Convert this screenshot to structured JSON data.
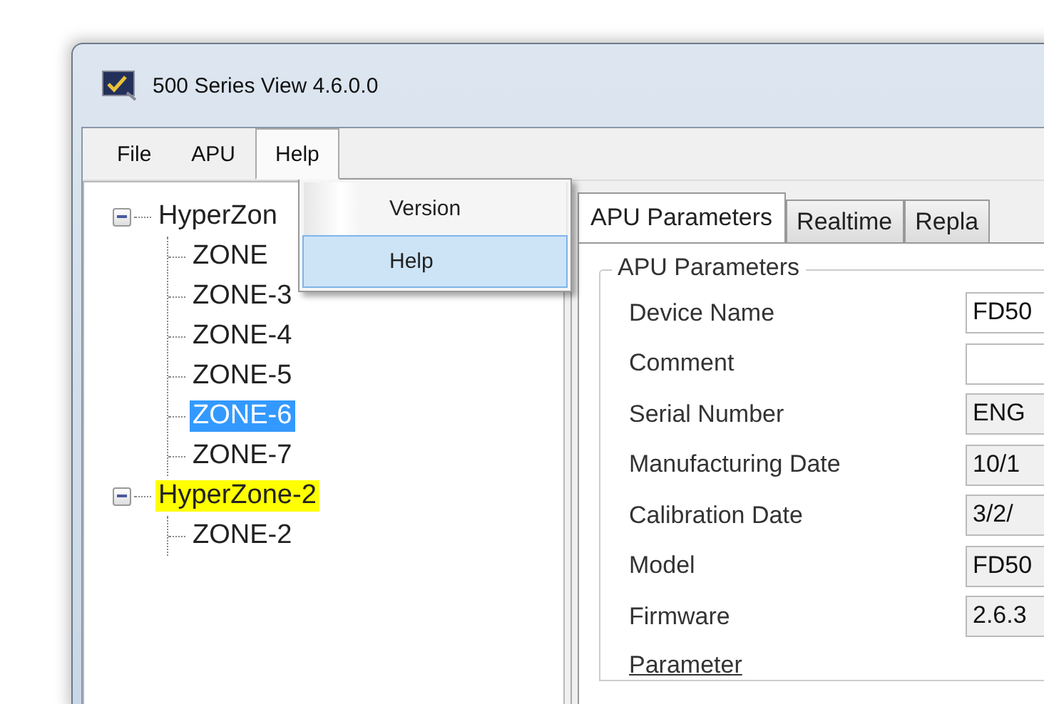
{
  "window": {
    "title": "500 Series View 4.6.0.0"
  },
  "menu": [
    {
      "label": "File",
      "open": false
    },
    {
      "label": "APU",
      "open": false
    },
    {
      "label": "Help",
      "open": true,
      "items": [
        {
          "label": "Version",
          "selected": false
        },
        {
          "label": "Help",
          "selected": true
        }
      ]
    }
  ],
  "tree": [
    {
      "label": "HyperZon",
      "expanded": true,
      "selected": false,
      "highlighted": false,
      "children": [
        {
          "label": "ZONE",
          "selected": false,
          "highlighted": false
        },
        {
          "label": "ZONE-3",
          "selected": false,
          "highlighted": false
        },
        {
          "label": "ZONE-4",
          "selected": false,
          "highlighted": false
        },
        {
          "label": "ZONE-5",
          "selected": false,
          "highlighted": false
        },
        {
          "label": "ZONE-6",
          "selected": true,
          "highlighted": false
        },
        {
          "label": "ZONE-7",
          "selected": false,
          "highlighted": false
        }
      ]
    },
    {
      "label": "HyperZone-2",
      "expanded": true,
      "selected": false,
      "highlighted": true,
      "children": [
        {
          "label": "ZONE-2",
          "selected": false,
          "highlighted": false
        }
      ]
    }
  ],
  "tabs": [
    {
      "label": "APU Parameters",
      "selected": true
    },
    {
      "label": "Realtime",
      "selected": false
    },
    {
      "label": "Repla",
      "selected": false
    }
  ],
  "group": {
    "title": "APU Parameters",
    "fields": [
      {
        "label": "Device Name",
        "value": "FD50",
        "readonly": false
      },
      {
        "label": "Comment",
        "readonly": false
      },
      {
        "label": "Serial Number",
        "value": "ENG",
        "readonly": true
      },
      {
        "label": "Manufacturing Date",
        "value": "10/1",
        "readonly": true
      },
      {
        "label": "Calibration Date",
        "value": "3/2/",
        "readonly": true
      },
      {
        "label": "Model",
        "value": "FD50",
        "readonly": true
      },
      {
        "label": "Firmware",
        "value": "2.6.3",
        "readonly": true
      }
    ],
    "link": "Parameter"
  }
}
